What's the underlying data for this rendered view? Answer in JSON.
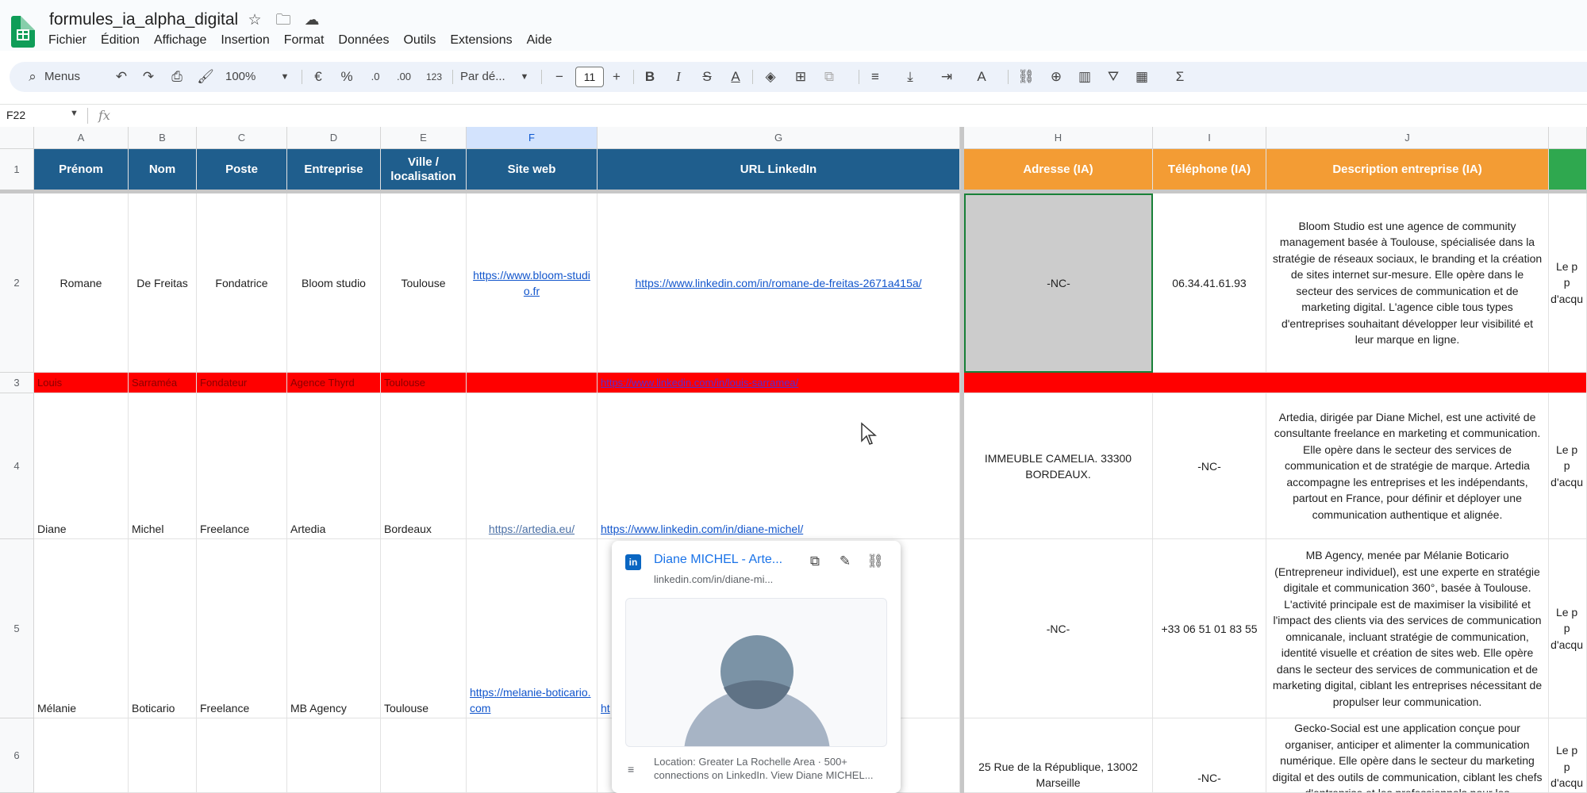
{
  "app": {
    "doc_title": "formules_ia_alpha_digital",
    "menu": [
      "Fichier",
      "Édition",
      "Affichage",
      "Insertion",
      "Format",
      "Données",
      "Outils",
      "Extensions",
      "Aide"
    ]
  },
  "toolbar": {
    "search_label": "Menus",
    "zoom": "100%",
    "currency": "€",
    "percent": "%",
    "dec_minus": ".0",
    "dec_plus": ".00",
    "number_format": "123",
    "font": "Par dé...",
    "font_size": "11",
    "bold": "B",
    "italic": "I",
    "sigma": "Σ"
  },
  "formula_bar": {
    "cell_ref": "F22",
    "fx": "fx"
  },
  "columns": [
    "A",
    "B",
    "C",
    "D",
    "E",
    "F",
    "G",
    "H",
    "I",
    "J"
  ],
  "rows": [
    "1",
    "2",
    "3",
    "4",
    "5",
    "6"
  ],
  "headers": {
    "prenom": "Prénom",
    "nom": "Nom",
    "poste": "Poste",
    "entreprise": "Entreprise",
    "ville": "Ville / localisation",
    "site": "Site web",
    "linkedin": "URL LinkedIn",
    "adresse": "Adresse (IA)",
    "telephone": "Téléphone (IA)",
    "description": "Description entreprise (IA)"
  },
  "data": {
    "r2": {
      "prenom": "Romane",
      "nom": "De Freitas",
      "poste": "Fondatrice",
      "entreprise": "Bloom studio",
      "ville": "Toulouse",
      "site": "https://www.bloom-studio.fr",
      "linkedin": "https://www.linkedin.com/in/romane-de-freitas-2671a415a/",
      "adresse": "-NC-",
      "telephone": "06.34.41.61.93",
      "description": "Bloom Studio est une agence de community management basée à Toulouse, spécialisée dans la stratégie de réseaux sociaux, le branding et la création de sites internet sur-mesure. Elle opère dans le secteur des services de communication et de marketing digital. L'agence cible tous types d'entreprises souhaitant développer leur visibilité et leur marque en ligne.",
      "k_clip": "Le p\np\nd'acqu"
    },
    "r3": {
      "prenom": "Louis",
      "nom": "Sarraméa",
      "poste": "Fondateur",
      "entreprise": "Agence Thyrd",
      "ville": "Toulouse",
      "linkedin": "https://www.linkedin.com/in/louis-sarramea/"
    },
    "r4": {
      "prenom": "Diane",
      "nom": "Michel",
      "poste": "Freelance",
      "entreprise": "Artedia",
      "ville": "Bordeaux",
      "site": "https://artedia.eu/",
      "linkedin": "https://www.linkedin.com/in/diane-michel/",
      "adresse": "IMMEUBLE CAMELIA. 33300 BORDEAUX.",
      "telephone": "-NC-",
      "description": "Artedia, dirigée par Diane Michel, est une activité de consultante freelance en marketing et communication. Elle opère dans le secteur des services de communication et de stratégie de marque. Artedia accompagne les entreprises et les indépendants, partout en France, pour définir et déployer une communication authentique et alignée.",
      "k_clip": "Le p\np\nd'acqu"
    },
    "r5": {
      "prenom": "Mélanie",
      "nom": "Boticario",
      "poste": "Freelance",
      "entreprise": "MB Agency",
      "ville": "Toulouse",
      "site": "https://melanie-boticario.com",
      "linkedin": "ht",
      "adresse": "-NC-",
      "telephone": "+33 06 51 01 83 55",
      "description": "MB Agency, menée par Mélanie Boticario (Entrepreneur individuel), est une experte en stratégie digitale et communication 360°, basée à Toulouse. L'activité principale est de maximiser la visibilité et l'impact des clients via des services de communication omnicanale, incluant stratégie de communication, identité visuelle et création de sites web. Elle opère dans le secteur des services de communication et de marketing digital, ciblant les entreprises nécessitant de propulser leur communication.",
      "k_clip": "Le p\np\nd'acqu"
    },
    "r6": {
      "adresse": "25 Rue de la République, 13002 Marseille",
      "telephone": "-NC-",
      "description": "Gecko-Social est une application conçue pour organiser, anticiper et alimenter la communication numérique. Elle opère dans le secteur du marketing digital et des outils de communication, ciblant les chefs d'entreprise et les professionnels pour les",
      "k_clip": "Le p\np\nd'acqu"
    }
  },
  "popup": {
    "title": "Diane MICHEL - Arte...",
    "url": "linkedin.com/in/diane-mi...",
    "description": "Location: Greater La Rochelle Area · 500+ connections on LinkedIn. View Diane MICHEL..."
  },
  "colors": {
    "header_blue": "#1f5e8d",
    "header_orange": "#f39c34",
    "header_green": "#2fa84f",
    "row_red": "#ff0000",
    "link": "#1155cc"
  }
}
